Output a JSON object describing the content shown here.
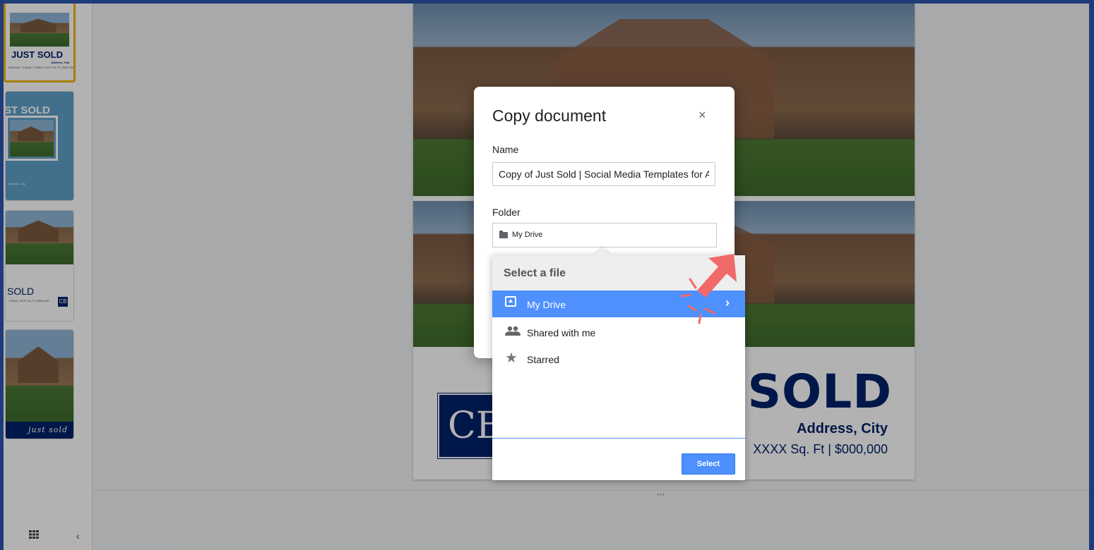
{
  "filmstrip": {
    "thumb1_title": "JUST SOLD",
    "thumb1_sub": "Address, City",
    "thumb1_details": "Bedroom | X Beds, X Baths, XXXX Sq. Ft | $000,000",
    "thumb2_title": "ST SOLD",
    "thumb2_sub": "Address, City",
    "thumb3_title": "SOLD",
    "thumb3_details": "X Beds, XXXX Sq. Ft | $000,000",
    "thumb4_title": "just sold"
  },
  "slide": {
    "logo": "CB",
    "sold": "SOLD",
    "address": "Address, City",
    "details": "XXXX Sq. Ft | $000,000"
  },
  "dialog": {
    "title": "Copy document",
    "close": "×",
    "name_label": "Name",
    "name_value": "Copy of Just Sold | Social Media Templates for Agents",
    "folder_label": "Folder",
    "folder_value": "My Drive"
  },
  "picker": {
    "title": "Select a file",
    "items": [
      {
        "label": "My Drive",
        "icon": "drive-icon",
        "selected": true
      },
      {
        "label": "Shared with me",
        "icon": "people-icon",
        "selected": false
      },
      {
        "label": "Starred",
        "icon": "star-icon",
        "selected": false
      }
    ],
    "select_label": "Select"
  },
  "colors": {
    "accent": "#4d90fe",
    "brand_navy": "#012169",
    "highlight_border": "#f4b400",
    "annotation": "#f06a6a"
  }
}
